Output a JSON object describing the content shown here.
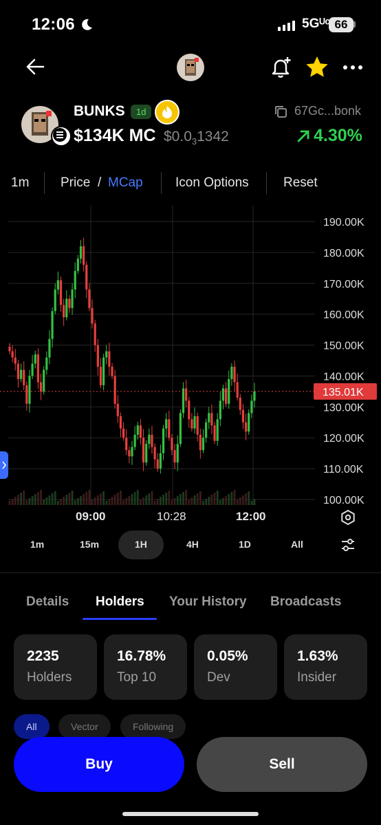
{
  "status_bar": {
    "time": "12:06",
    "network": "5Gᵁᶜ",
    "battery": "66"
  },
  "token": {
    "name": "BUNKS",
    "age_badge": "1d",
    "market_cap": "$134K MC",
    "price_prefix": "$0.0",
    "price_zero_count": "3",
    "price_digits": "1342",
    "address": "67Gc...bonk",
    "change": "4.30%",
    "change_color": "#2fd04f"
  },
  "chart_toolbar": {
    "interval": "1m",
    "price": "Price",
    "slash": "/",
    "mcap": "MCap",
    "icon_options": "Icon Options",
    "reset": "Reset"
  },
  "chart_data": {
    "type": "candlestick",
    "y_ticks": [
      "190.00K",
      "180.00K",
      "170.00K",
      "160.00K",
      "150.00K",
      "140.00K",
      "130.00K",
      "120.00K",
      "110.00K",
      "100.00K"
    ],
    "x_ticks": [
      "09:00",
      "10:28",
      "12:00"
    ],
    "current_price_label": "135.01K",
    "current_value": 135.01,
    "ylim": [
      100,
      190
    ],
    "up_color": "#35c043",
    "down_color": "#e5403d",
    "close_series": [
      148,
      146,
      144,
      139,
      142,
      137,
      131,
      140,
      144,
      147,
      138,
      135,
      142,
      146,
      152,
      161,
      168,
      171,
      163,
      159,
      165,
      162,
      168,
      174,
      178,
      182,
      176,
      168,
      162,
      157,
      150,
      143,
      137,
      146,
      148,
      143,
      140,
      131,
      127,
      123,
      120,
      116,
      114,
      117,
      121,
      124,
      120,
      112,
      118,
      121,
      117,
      113,
      110,
      115,
      123,
      126,
      120,
      116,
      112,
      118,
      128,
      136,
      132,
      126,
      123,
      127,
      121,
      116,
      120,
      125,
      128,
      124,
      119,
      126,
      132,
      136,
      131,
      139,
      143,
      138,
      133,
      129,
      125,
      122,
      128,
      132,
      135
    ]
  },
  "intervals": [
    "1m",
    "15m",
    "1H",
    "4H",
    "1D",
    "All"
  ],
  "active_interval": "1H",
  "tabs": [
    "Details",
    "Holders",
    "Your History",
    "Broadcasts"
  ],
  "active_tab": "Holders",
  "stats": [
    {
      "value": "2235",
      "label": "Holders"
    },
    {
      "value": "16.78%",
      "label": "Top 10"
    },
    {
      "value": "0.05%",
      "label": "Dev"
    },
    {
      "value": "1.63%",
      "label": "Insider"
    }
  ],
  "filters": [
    "All",
    "Vector",
    "Following"
  ],
  "actions": {
    "buy": "Buy",
    "sell": "Sell"
  }
}
